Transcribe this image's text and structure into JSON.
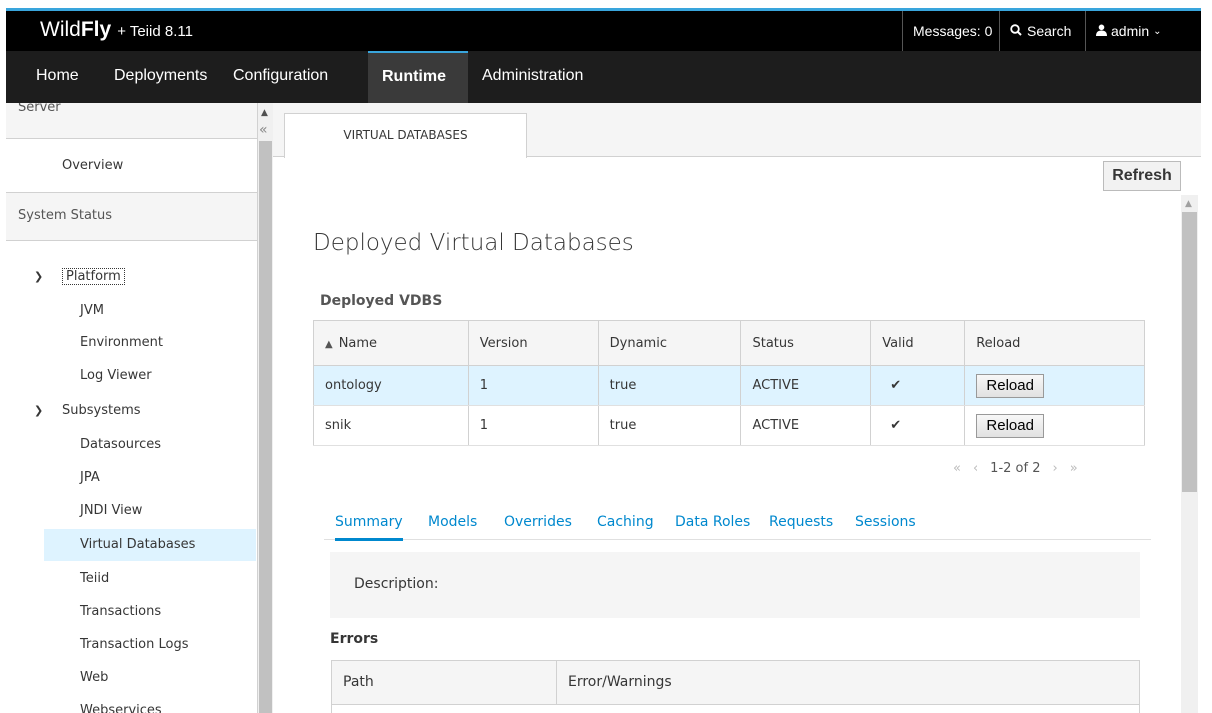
{
  "header": {
    "brand_wild": "Wild",
    "brand_fly": "Fly",
    "brand_suffix": "+ Teiid 8.11",
    "messages": "Messages: 0",
    "search": "Search",
    "user": "admin",
    "accent_color": "#39a5dc"
  },
  "nav": {
    "items": [
      "Home",
      "Deployments",
      "Configuration",
      "Runtime",
      "Administration"
    ],
    "active": "Runtime"
  },
  "sidebar": {
    "server_header": "Server",
    "overview": "Overview",
    "system_status": "System Status",
    "platform": "Platform",
    "platform_items": [
      "JVM",
      "Environment",
      "Log Viewer"
    ],
    "subsystems": "Subsystems",
    "subsystem_items": [
      "Datasources",
      "JPA",
      "JNDI View",
      "Virtual Databases",
      "Teiid",
      "Transactions",
      "Transaction Logs",
      "Web",
      "Webservices"
    ],
    "selected": "Virtual Databases"
  },
  "main": {
    "top_tab": "VIRTUAL DATABASES",
    "refresh": "Refresh",
    "title": "Deployed Virtual Databases",
    "subtitle": "Deployed VDBS",
    "table": {
      "columns": [
        "Name",
        "Version",
        "Dynamic",
        "Status",
        "Valid",
        "Reload"
      ],
      "rows": [
        {
          "name": "ontology",
          "version": "1",
          "dynamic": "true",
          "status": "ACTIVE",
          "valid": "✔",
          "reload": "Reload"
        },
        {
          "name": "snik",
          "version": "1",
          "dynamic": "true",
          "status": "ACTIVE",
          "valid": "✔",
          "reload": "Reload"
        }
      ],
      "pager": "1-2 of 2"
    },
    "subtabs": [
      "Summary",
      "Models",
      "Overrides",
      "Caching",
      "Data Roles",
      "Requests",
      "Sessions"
    ],
    "description_label": "Description:",
    "errors_title": "Errors",
    "errors_columns": [
      "Path",
      "Error/Warnings"
    ]
  }
}
